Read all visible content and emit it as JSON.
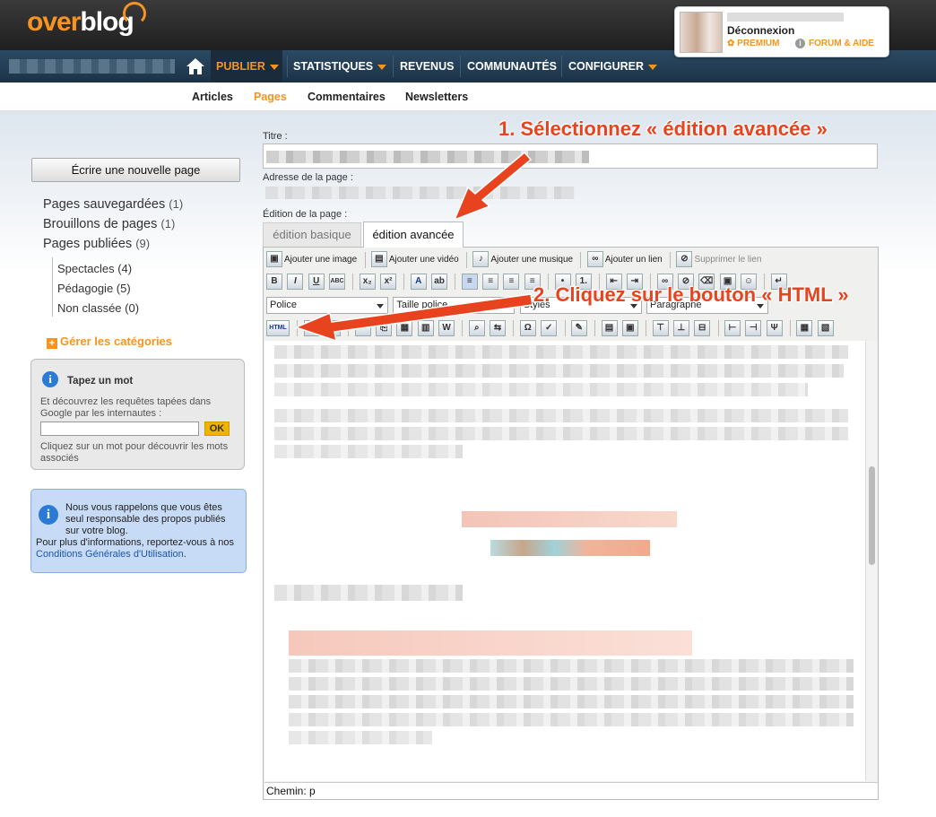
{
  "header": {
    "logo_over": "over",
    "logo_blog": "blog",
    "user": {
      "logout": "Déconnexion",
      "premium": "PREMIUM",
      "forum": "FORUM & AIDE"
    }
  },
  "nav": {
    "items": [
      {
        "label": "PUBLIER",
        "active": true,
        "dropdown": true
      },
      {
        "label": "STATISTIQUES",
        "dropdown": true
      },
      {
        "label": "REVENUS"
      },
      {
        "label": "COMMUNAUTÉS"
      },
      {
        "label": "CONFIGURER",
        "dropdown": true
      }
    ]
  },
  "subnav": {
    "items": [
      "Articles",
      "Pages",
      "Commentaires",
      "Newsletters"
    ],
    "active": "Pages"
  },
  "sidebar": {
    "new_page_button": "Écrire une nouvelle page",
    "pages": [
      {
        "label": "Pages sauvegardées",
        "count": "(1)"
      },
      {
        "label": "Brouillons de pages",
        "count": "(1)"
      },
      {
        "label": "Pages publiées",
        "count": "(9)"
      }
    ],
    "subpages": [
      {
        "label": "Spectacles",
        "count": "(4)"
      },
      {
        "label": "Pédagogie",
        "count": "(5)"
      },
      {
        "label": "Non classée",
        "count": "(0)"
      }
    ],
    "manage_categories": "Gérer les catégories",
    "word_box": {
      "title": "Tapez un mot",
      "description": "Et découvrez les requêtes tapées dans Google par les internautes :",
      "ok": "OK",
      "hint": "Cliquez sur un mot pour découvrir les mots associés"
    },
    "notice": {
      "text1": "Nous vous rappelons que vous êtes seul responsable des propos publiés sur votre blog.",
      "text2": "Pour plus d'informations, reportez-vous à nos",
      "link": "Conditions Générales d'Utilisation",
      "end": "."
    }
  },
  "form": {
    "title_label": "Titre :",
    "address_label": "Adresse de la page :",
    "edition_label": "Édition de la page :",
    "tabs": {
      "basic": "édition basique",
      "advanced": "édition avancée",
      "selected": "advanced"
    }
  },
  "toolbar": {
    "add_image": "Ajouter une image",
    "add_video": "Ajouter une vidéo",
    "add_music": "Ajouter une musique",
    "add_link": "Ajouter un lien",
    "remove_link": "Supprimer le lien",
    "font_select": "Police",
    "size_select": "Taille police",
    "styles_select": "Styles",
    "format_select": "Paragraphe",
    "html_button": "HTML"
  },
  "editor": {
    "path": "Chemin: p"
  },
  "annotations": {
    "step1": "1. Sélectionnez « édition avancée »",
    "step2": "2. Cliquez sur le bouton « HTML »",
    "color": "#e8431f"
  },
  "colors": {
    "brand_orange": "#f7941d",
    "nav_blue": "#1b3348",
    "link_blue": "#1a55b0"
  }
}
